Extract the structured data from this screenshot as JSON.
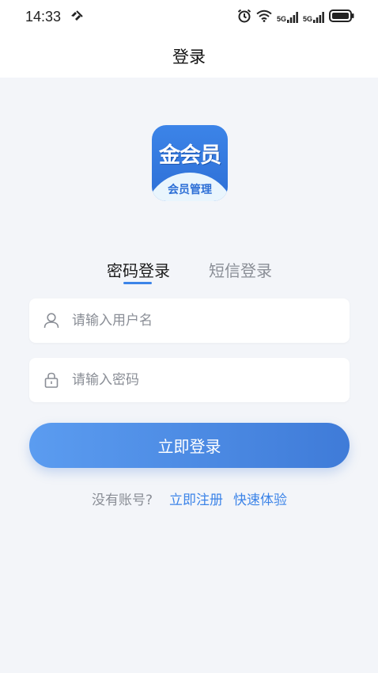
{
  "status_bar": {
    "time": "14:33",
    "network_left": "5G",
    "network_right": "5G",
    "icons": [
      "vibrate-icon",
      "alarm-icon",
      "wifi-icon",
      "signal-5g-icon",
      "signal-5g-icon",
      "battery-icon"
    ]
  },
  "header": {
    "title": "登录"
  },
  "logo": {
    "main_text": "金会员",
    "sub_text": "会员管理"
  },
  "tabs": {
    "password_login": "密码登录",
    "sms_login": "短信登录",
    "active": "password_login"
  },
  "form": {
    "username": {
      "value": "",
      "placeholder": "请输入用户名",
      "icon": "user-icon"
    },
    "password": {
      "value": "",
      "placeholder": "请输入密码",
      "icon": "lock-icon"
    },
    "submit_label": "立即登录"
  },
  "footer_links": {
    "no_account": "没有账号?",
    "register": "立即注册",
    "trial": "快速体验"
  },
  "colors": {
    "accent": "#3c84e8",
    "background": "#f3f5f9",
    "muted_text": "#8a8e96"
  }
}
